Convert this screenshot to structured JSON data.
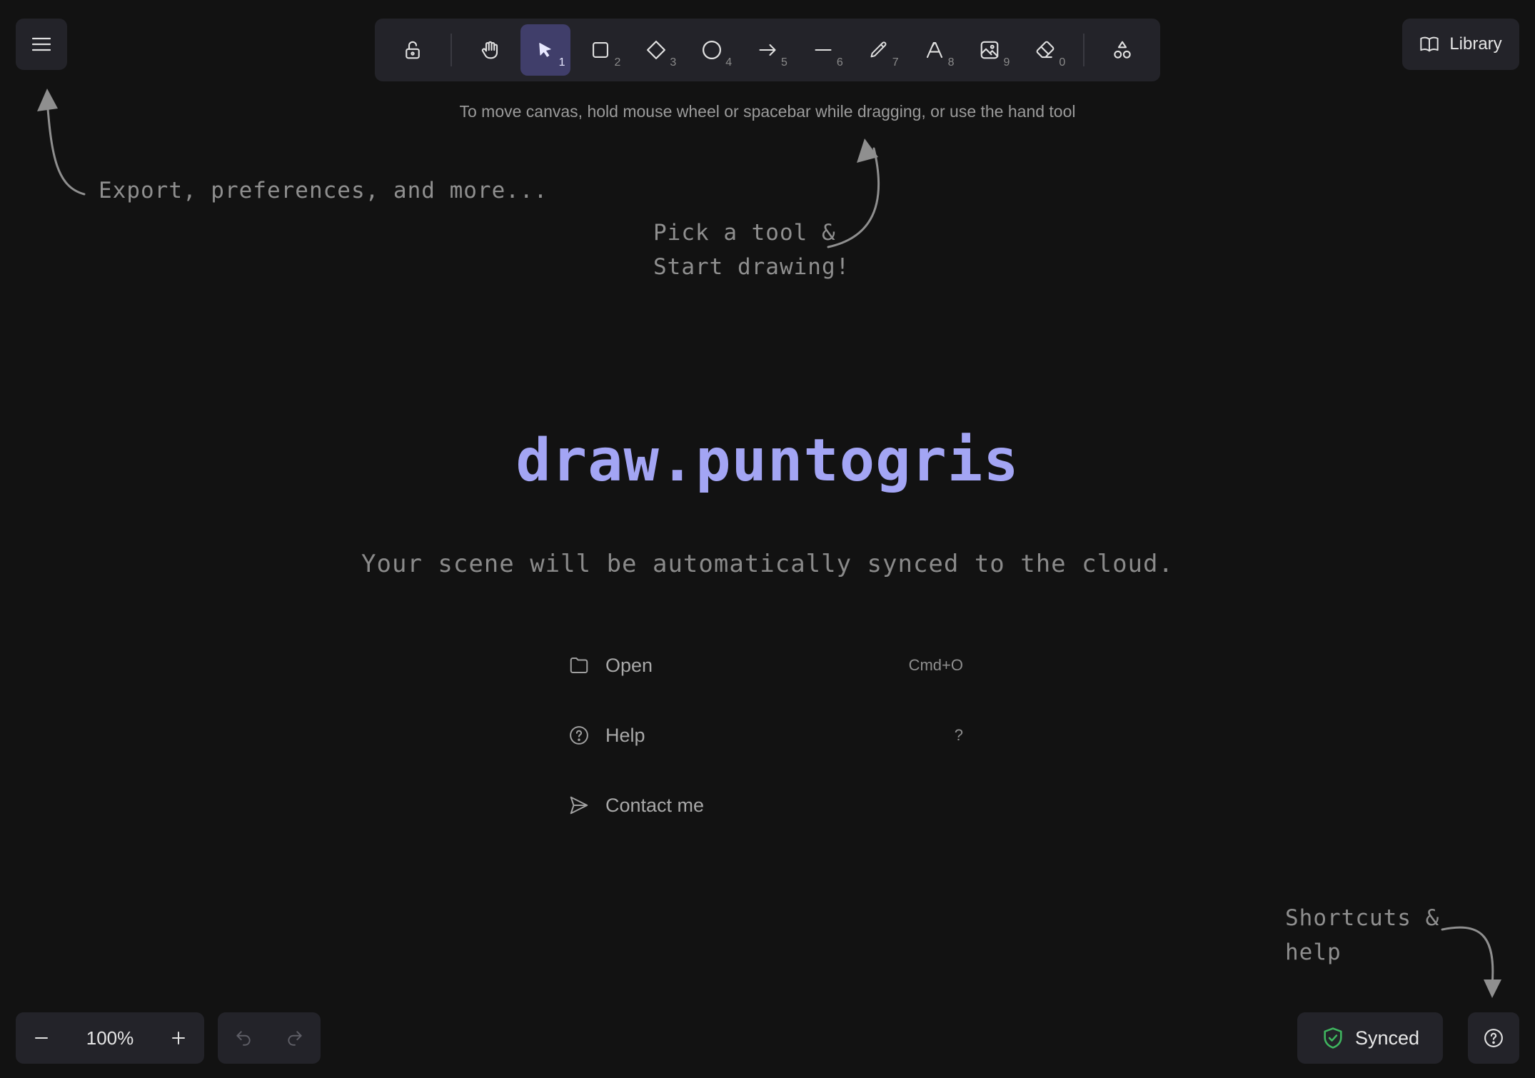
{
  "toolbar": {
    "tools": [
      {
        "name": "lock",
        "icon": "lock-open-icon",
        "key": ""
      },
      {
        "name": "hand",
        "icon": "hand-icon",
        "key": ""
      },
      {
        "name": "selection",
        "icon": "pointer-icon",
        "key": "1",
        "active": true
      },
      {
        "name": "rectangle",
        "icon": "square-icon",
        "key": "2"
      },
      {
        "name": "diamond",
        "icon": "diamond-icon",
        "key": "3"
      },
      {
        "name": "ellipse",
        "icon": "circle-icon",
        "key": "4"
      },
      {
        "name": "arrow",
        "icon": "arrow-right-icon",
        "key": "5"
      },
      {
        "name": "line",
        "icon": "line-icon",
        "key": "6"
      },
      {
        "name": "draw",
        "icon": "pencil-icon",
        "key": "7"
      },
      {
        "name": "text",
        "icon": "text-icon",
        "key": "8"
      },
      {
        "name": "image",
        "icon": "image-icon",
        "key": "9"
      },
      {
        "name": "eraser",
        "icon": "eraser-icon",
        "key": "0"
      },
      {
        "name": "extra-tools",
        "icon": "shapes-icon",
        "key": ""
      }
    ],
    "hint": "To move canvas, hold mouse wheel or spacebar while dragging, or use the hand tool"
  },
  "library": {
    "label": "Library",
    "icon": "book-icon"
  },
  "annotations": {
    "menu_hint": "Export, preferences, and more...",
    "tool_hint_line1": "Pick a tool &",
    "tool_hint_line2": "Start drawing!",
    "help_hint_line1": "Shortcuts &",
    "help_hint_line2": "help"
  },
  "welcome": {
    "brand": "draw.puntogris",
    "tagline": "Your scene will be automatically synced to the cloud.",
    "items": [
      {
        "label": "Open",
        "shortcut": "Cmd+O",
        "icon": "folder-icon"
      },
      {
        "label": "Help",
        "shortcut": "?",
        "icon": "help-circle-icon"
      },
      {
        "label": "Contact me",
        "shortcut": "",
        "icon": "send-icon"
      }
    ]
  },
  "footer": {
    "zoom": "100%",
    "sync_label": "Synced",
    "sync_color": "#3fb65f",
    "accent_color": "#a3a5f4"
  }
}
